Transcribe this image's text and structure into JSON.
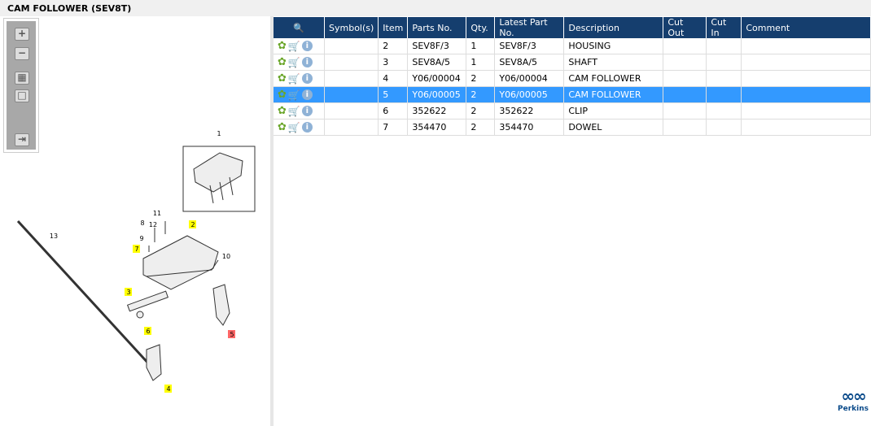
{
  "title": "CAM FOLLOWER (SEV8T)",
  "toolbar": {
    "zoom_in": "+",
    "zoom_out": "−",
    "fit": "▦",
    "actual": "□",
    "layout": "⇥"
  },
  "table": {
    "headers": [
      "",
      "Symbol(s)",
      "Item",
      "Parts No.",
      "Qty.",
      "Latest Part No.",
      "Description",
      "Cut Out",
      "Cut In",
      "Comment"
    ],
    "rows": [
      {
        "item": "2",
        "part": "SEV8F/3",
        "qty": "1",
        "latest": "SEV8F/3",
        "desc": "HOUSING"
      },
      {
        "item": "3",
        "part": "SEV8A/5",
        "qty": "1",
        "latest": "SEV8A/5",
        "desc": "SHAFT"
      },
      {
        "item": "4",
        "part": "Y06/00004",
        "qty": "2",
        "latest": "Y06/00004",
        "desc": "CAM FOLLOWER"
      },
      {
        "item": "5",
        "part": "Y06/00005",
        "qty": "2",
        "latest": "Y06/00005",
        "desc": "CAM FOLLOWER"
      },
      {
        "item": "6",
        "part": "352622",
        "qty": "2",
        "latest": "352622",
        "desc": "CLIP"
      },
      {
        "item": "7",
        "part": "354470",
        "qty": "2",
        "latest": "354470",
        "desc": "DOWEL"
      }
    ],
    "selected_index": 3
  },
  "diagram": {
    "callouts": [
      "1",
      "2",
      "3",
      "4",
      "5",
      "6",
      "7",
      "8",
      "9",
      "10",
      "11",
      "12",
      "13"
    ]
  },
  "colors": {
    "header": "#153e6e",
    "selected": "#3399ff",
    "highlight": "#ffff00",
    "highlight_selected": "#ff6666"
  },
  "logo": {
    "text": "Perkins"
  }
}
